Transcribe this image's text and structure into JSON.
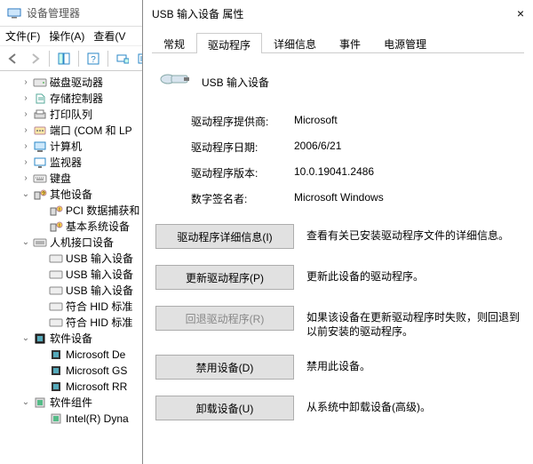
{
  "dm": {
    "title": "设备管理器",
    "menu": {
      "file": "文件(F)",
      "action": "操作(A)",
      "view": "查看(V"
    },
    "tree": {
      "disk": "磁盘驱动器",
      "storage": "存储控制器",
      "printq": "打印队列",
      "ports": "端口 (COM 和 LP",
      "computer": "计算机",
      "monitor": "监视器",
      "keyboard": "键盘",
      "other": "其他设备",
      "other_pci": "PCI 数据捕获和",
      "other_base": "基本系统设备",
      "hid": "人机接口设备",
      "hid_usb1": "USB 输入设备",
      "hid_usb2": "USB 输入设备",
      "hid_usb3": "USB 输入设备",
      "hid_std1": "符合 HID 标准",
      "hid_std2": "符合 HID 标准",
      "sw": "软件设备",
      "sw_ms_de": "Microsoft De",
      "sw_ms_gs": "Microsoft GS",
      "sw_ms_rr": "Microsoft RR",
      "swc": "软件组件",
      "swc_intel": "Intel(R) Dyna"
    }
  },
  "prop": {
    "title": "USB 输入设备 属性",
    "tabs": {
      "general": "常规",
      "driver": "驱动程序",
      "details": "详细信息",
      "events": "事件",
      "power": "电源管理"
    },
    "device_name": "USB 输入设备",
    "labels": {
      "provider": "驱动程序提供商:",
      "date": "驱动程序日期:",
      "version": "驱动程序版本:",
      "signer": "数字签名者:"
    },
    "values": {
      "provider": "Microsoft",
      "date": "2006/6/21",
      "version": "10.0.19041.2486",
      "signer": "Microsoft Windows"
    },
    "actions": {
      "details_btn": "驱动程序详细信息(I)",
      "details_desc": "查看有关已安装驱动程序文件的详细信息。",
      "update_btn": "更新驱动程序(P)",
      "update_desc": "更新此设备的驱动程序。",
      "rollback_btn": "回退驱动程序(R)",
      "rollback_desc": "如果该设备在更新驱动程序时失败，则回退到以前安装的驱动程序。",
      "disable_btn": "禁用设备(D)",
      "disable_desc": "禁用此设备。",
      "uninstall_btn": "卸载设备(U)",
      "uninstall_desc": "从系统中卸载设备(高级)。"
    }
  }
}
